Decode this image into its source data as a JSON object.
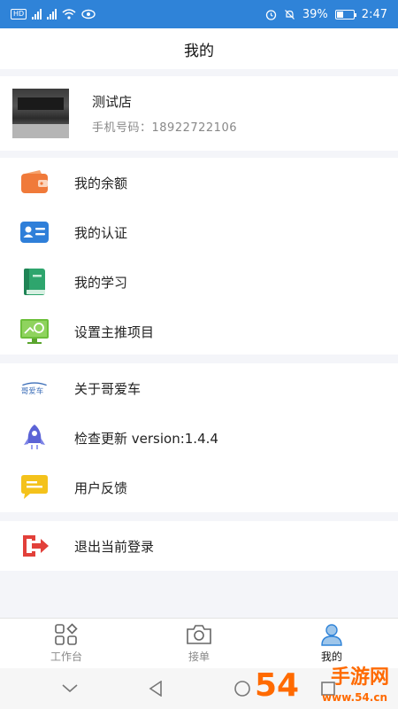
{
  "status_bar": {
    "hd": "HD",
    "battery": "39%",
    "battery_level": 0.39,
    "time": "2:47"
  },
  "header": {
    "title": "我的"
  },
  "profile": {
    "store_name": "测试店",
    "phone": "手机号码：18922722106"
  },
  "menu": {
    "balance": "我的余额",
    "certification": "我的认证",
    "study": "我的学习",
    "main_project": "设置主推项目",
    "about": "关于哥爱车",
    "about_logo_text": "哥爱车",
    "update": "检查更新  version:1.4.4",
    "feedback": "用户反馈",
    "logout": "退出当前登录"
  },
  "bottom_nav": {
    "workbench": "工作台",
    "orders": "接单",
    "mine": "我的"
  },
  "watermark": {
    "number": "54",
    "text": "手游网",
    "url": "www.54.cn"
  },
  "colors": {
    "status_bar": "#2f83d8",
    "orange": "#f07a3a",
    "blue": "#2f7fd9",
    "green": "#2ea56d",
    "lime": "#6cbf3a",
    "purple": "#5b63d6",
    "yellow": "#f4c21b",
    "red": "#e2403a"
  }
}
